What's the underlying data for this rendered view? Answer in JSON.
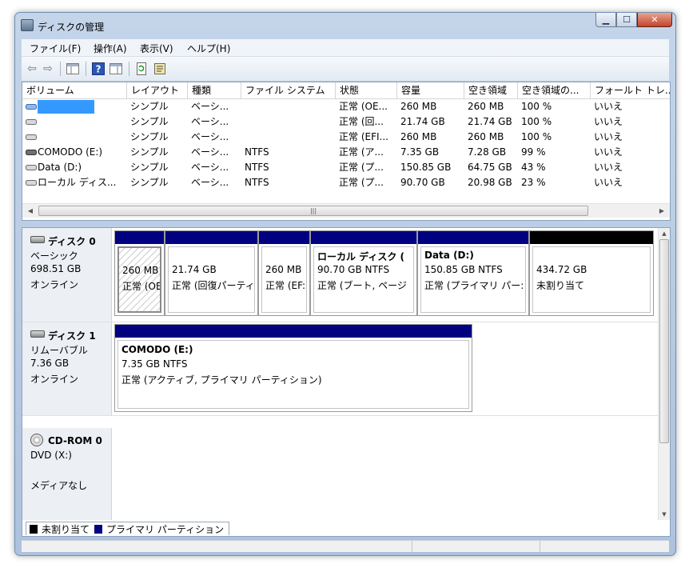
{
  "window": {
    "title": "ディスクの管理",
    "min": "▁",
    "max": "☐",
    "close": "✕"
  },
  "menu": [
    "ファイル(F)",
    "操作(A)",
    "表示(V)",
    "ヘルプ(H)"
  ],
  "toolbar": {
    "back": "⇦",
    "forward": "⇨",
    "help": "?"
  },
  "columns": [
    "ボリューム",
    "レイアウト",
    "種類",
    "ファイル システム",
    "状態",
    "容量",
    "空き領域",
    "空き領域の...",
    "フォールト トレ..."
  ],
  "volumes": [
    {
      "name": "",
      "layout": "シンプル",
      "type": "ベーシ...",
      "fs": "",
      "status": "正常 (OE...",
      "capacity": "260 MB",
      "free": "260 MB",
      "pct": "100 %",
      "ft": "いいえ"
    },
    {
      "name": "",
      "layout": "シンプル",
      "type": "ベーシ...",
      "fs": "",
      "status": "正常 (回...",
      "capacity": "21.74 GB",
      "free": "21.74 GB",
      "pct": "100 %",
      "ft": "いいえ"
    },
    {
      "name": "",
      "layout": "シンプル",
      "type": "ベーシ...",
      "fs": "",
      "status": "正常 (EFI...",
      "capacity": "260 MB",
      "free": "260 MB",
      "pct": "100 %",
      "ft": "いいえ"
    },
    {
      "name": "COMODO (E:)",
      "layout": "シンプル",
      "type": "ベーシ...",
      "fs": "NTFS",
      "status": "正常 (ア...",
      "capacity": "7.35 GB",
      "free": "7.28 GB",
      "pct": "99 %",
      "ft": "いいえ"
    },
    {
      "name": "Data (D:)",
      "layout": "シンプル",
      "type": "ベーシ...",
      "fs": "NTFS",
      "status": "正常 (プ...",
      "capacity": "150.85 GB",
      "free": "64.75 GB",
      "pct": "43 %",
      "ft": "いいえ"
    },
    {
      "name": "ローカル ディス...",
      "layout": "シンプル",
      "type": "ベーシ...",
      "fs": "NTFS",
      "status": "正常 (プ...",
      "capacity": "90.70 GB",
      "free": "20.98 GB",
      "pct": "23 %",
      "ft": "いいえ"
    }
  ],
  "disks": [
    {
      "name": "ディスク 0",
      "kind": "ベーシック",
      "size": "698.51 GB",
      "state": "オンライン",
      "partitions": [
        {
          "title": "",
          "size": "260 MB",
          "status": "正常 (OE"
        },
        {
          "title": "",
          "size": "21.74 GB",
          "status": "正常 (回復パーティ"
        },
        {
          "title": "",
          "size": "260 MB",
          "status": "正常 (EF:"
        },
        {
          "title": "ローカル ディスク (",
          "size": "90.70 GB NTFS",
          "status": "正常 (ブート, ページ"
        },
        {
          "title": "Data  (D:)",
          "size": "150.85 GB NTFS",
          "status": "正常 (プライマリ パー:"
        },
        {
          "title": "",
          "size": "434.72 GB",
          "status": "未割り当て"
        }
      ]
    },
    {
      "name": "ディスク 1",
      "kind": "リムーバブル",
      "size": "7.36 GB",
      "state": "オンライン",
      "partitions": [
        {
          "title": "COMODO  (E:)",
          "size": "7.35 GB NTFS",
          "status": "正常 (アクティブ, プライマリ パーティション)"
        }
      ]
    },
    {
      "name": "CD-ROM 0",
      "kind": "DVD (X:)",
      "state": "メディアなし"
    }
  ],
  "legend": {
    "unallocated": "未割り当て",
    "primary": "プライマリ パーティション"
  },
  "colors": {
    "primary": "#000080",
    "unallocated": "#000000",
    "selection": "#3399ff"
  }
}
